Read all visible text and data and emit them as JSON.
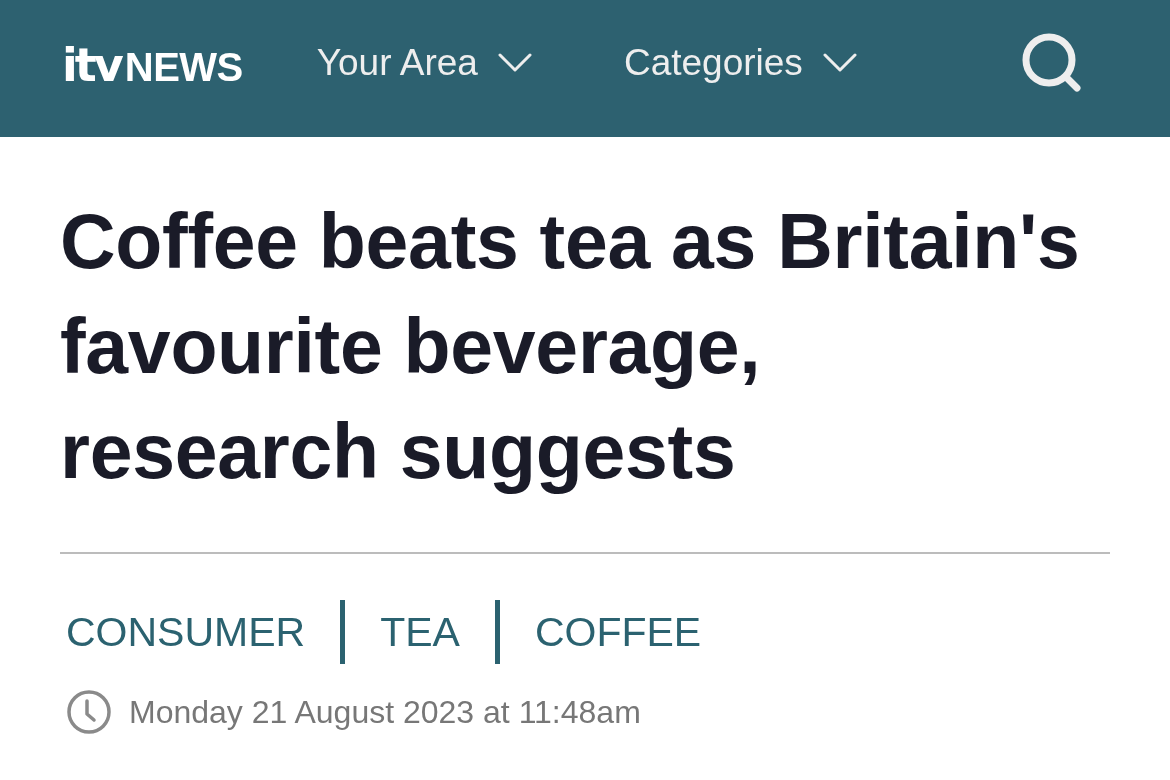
{
  "header": {
    "logo": {
      "mark": "itv",
      "text": "NEWS"
    },
    "nav": [
      {
        "label": "Your Area"
      },
      {
        "label": "Categories"
      }
    ]
  },
  "article": {
    "headline": "Coffee beats tea as Britain's favourite beverage, research suggests",
    "tags": [
      "CONSUMER",
      "TEA",
      "COFFEE"
    ],
    "published": "Monday 21 August 2023 at 11:48am"
  }
}
